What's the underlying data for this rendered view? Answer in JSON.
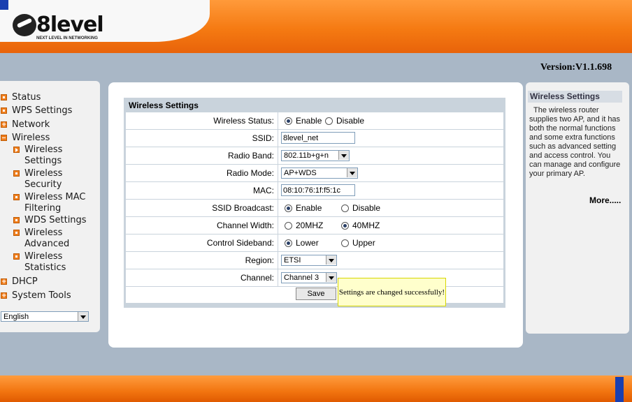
{
  "brand": {
    "name": "8level",
    "tagline": "NEXT LEVEL IN NETWORKING"
  },
  "version": "Version:V1.1.698",
  "nav": {
    "items": [
      {
        "label": "Status"
      },
      {
        "label": "WPS Settings"
      },
      {
        "label": "Network"
      },
      {
        "label": "Wireless"
      },
      {
        "label": "Wireless Settings"
      },
      {
        "label": "Wireless Security"
      },
      {
        "label": "Wireless MAC Filtering"
      },
      {
        "label": "WDS Settings"
      },
      {
        "label": "Wireless Advanced"
      },
      {
        "label": "Wireless Statistics"
      },
      {
        "label": "DHCP"
      },
      {
        "label": "System Tools"
      }
    ],
    "language": "English"
  },
  "form": {
    "title": "Wireless Settings",
    "wireless_status": {
      "label": "Wireless Status:",
      "enable": "Enable",
      "disable": "Disable"
    },
    "ssid": {
      "label": "SSID:",
      "value": "8level_net"
    },
    "radio_band": {
      "label": "Radio Band:",
      "value": "802.11b+g+n"
    },
    "radio_mode": {
      "label": "Radio Mode:",
      "value": "AP+WDS"
    },
    "mac": {
      "label": "MAC:",
      "value": "08:10:76:1f:f5:1c"
    },
    "ssid_broadcast": {
      "label": "SSID Broadcast:",
      "enable": "Enable",
      "disable": "Disable"
    },
    "channel_width": {
      "label": "Channel Width:",
      "opt1": "20MHZ",
      "opt2": "40MHZ"
    },
    "control_sideband": {
      "label": "Control Sideband:",
      "opt1": "Lower",
      "opt2": "Upper"
    },
    "region": {
      "label": "Region:",
      "value": "ETSI"
    },
    "channel": {
      "label": "Channel:",
      "value": "Channel 3"
    },
    "save_label": "Save",
    "tooltip": "Settings are changed successfully!"
  },
  "help": {
    "title": "Wireless Settings",
    "text": "The wireless router supplies two AP, and it has both the normal functions and some extra functions such as advanced setting and access control. You can manage and configure your primary AP.",
    "more": "More....."
  },
  "colors": {
    "accent": "#f57a12",
    "background": "#a9b7c6",
    "tooltip_bg": "#ffffcc"
  }
}
